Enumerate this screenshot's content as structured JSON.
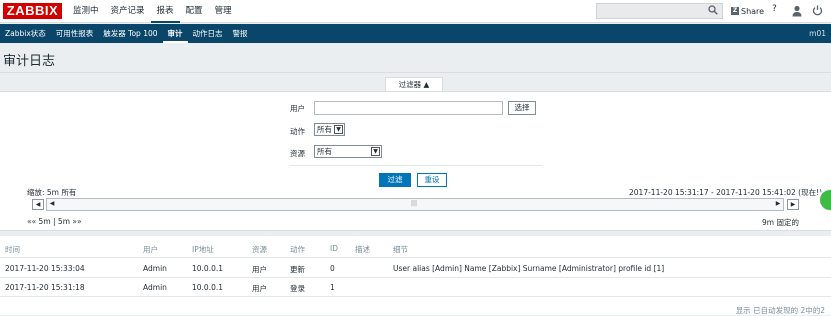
{
  "topbar": {
    "logo": "ZABBIX",
    "menu": [
      "监测中",
      "资产记录",
      "报表",
      "配置",
      "管理"
    ],
    "share_label": "Share",
    "help_label": "?"
  },
  "submenu": {
    "items": [
      "Zabbix状态",
      "可用性报表",
      "触发器 Top 100",
      "审计",
      "动作日志",
      "警报"
    ],
    "server": "m01"
  },
  "page": {
    "title": "审计日志"
  },
  "filter": {
    "tab_label": "过滤器 ▲",
    "user_label": "用户",
    "user_value": "",
    "select_button": "选择",
    "action_label": "动作",
    "action_value": "所有",
    "resource_label": "资源",
    "resource_value": "所有",
    "filter_button": "过滤",
    "reset_button": "重设"
  },
  "zoom": {
    "label": "缩放: 5m  所有",
    "range": "2017-11-20 15:31:17 - 2017-11-20 15:41:02 (现在!)",
    "left_nav": "«« 5m | 5m »»",
    "right_text": "9m  固定的"
  },
  "table": {
    "headers": [
      "时间",
      "用户",
      "IP地址",
      "资源",
      "动作",
      "ID",
      "描述",
      "细节"
    ],
    "rows": [
      [
        "2017-11-20 15:33:04",
        "Admin",
        "10.0.0.1",
        "用户",
        "更新",
        "0",
        "",
        "User alias [Admin] Name [Zabbix] Surname [Administrator] profile id [1]"
      ],
      [
        "2017-11-20 15:31:18",
        "Admin",
        "10.0.0.1",
        "用户",
        "登录",
        "1",
        "",
        ""
      ]
    ]
  },
  "footer": "显示 已自动发现的 2中的2",
  "colors": {
    "brand": "#d40000",
    "nav": "#0a466a",
    "primary": "#0275b8"
  }
}
